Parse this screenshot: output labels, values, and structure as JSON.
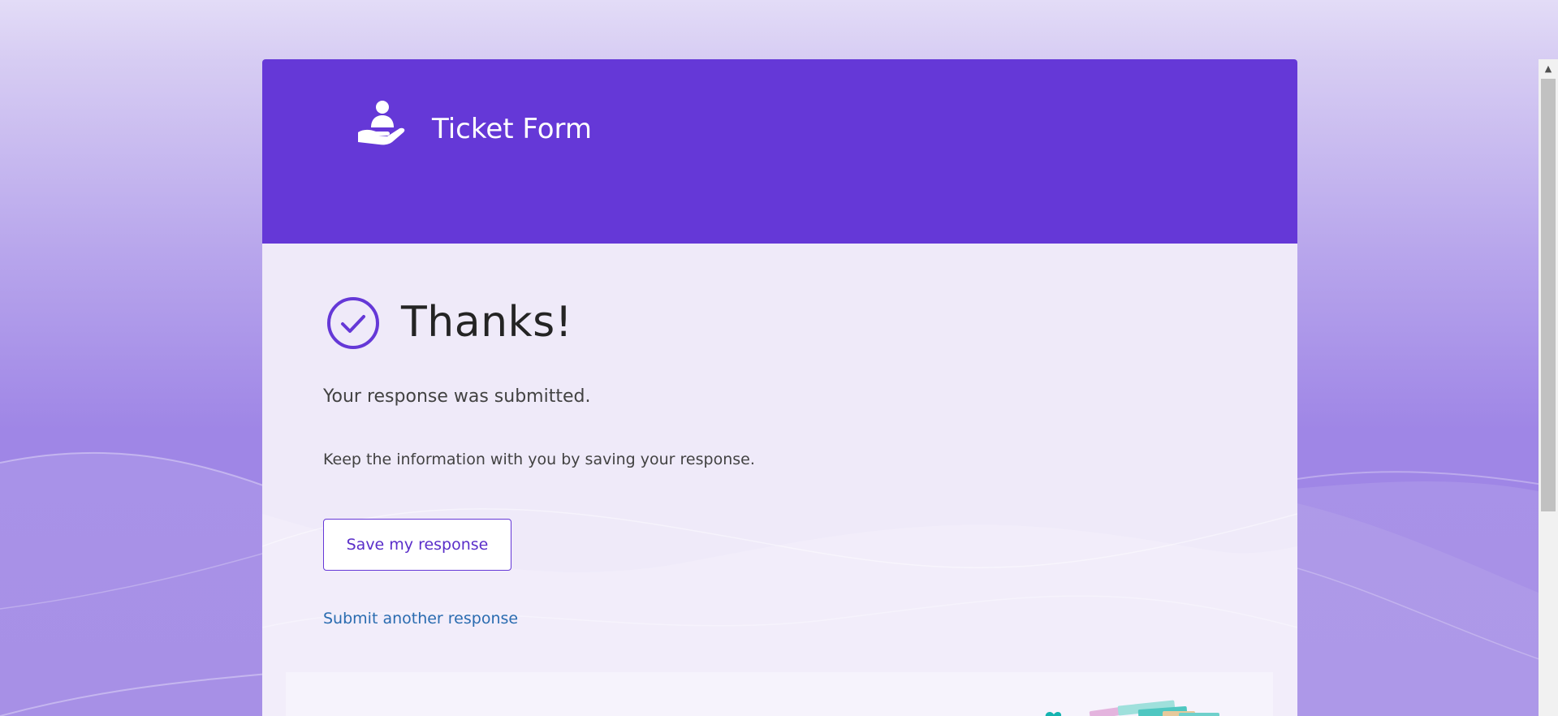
{
  "header": {
    "title": "Ticket Form",
    "brand_icon": "hand-with-person-icon"
  },
  "confirmation": {
    "status_icon": "check-circle-icon",
    "heading": "Thanks!",
    "message": "Your response was submitted.",
    "save_hint": "Keep the information with you by saving your response.",
    "save_button_label": "Save my response",
    "submit_another_label": "Submit another response"
  },
  "scrollbar": {
    "up_arrow": "▲"
  },
  "colors": {
    "banner": "#6538d7",
    "accent": "#6538d7",
    "link": "#2a6cb0",
    "page_background": "#b8a6ec"
  }
}
